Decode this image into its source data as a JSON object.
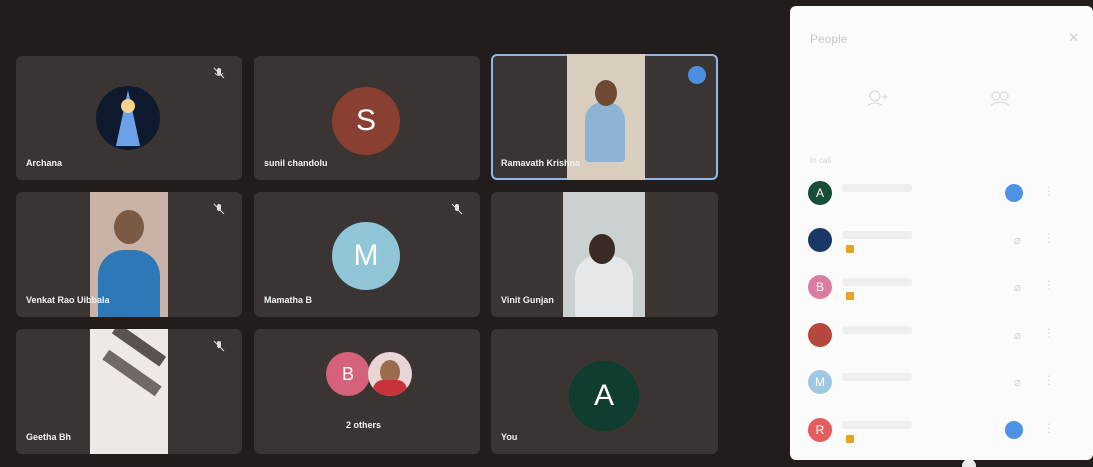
{
  "participants": [
    {
      "name": "Archana"
    },
    {
      "name": "sunil chandolu",
      "initial": "S"
    },
    {
      "name": "Ramavath Krishna"
    },
    {
      "name": "Venkat Rao Uibbala"
    },
    {
      "name": "Mamatha B",
      "initial": "M"
    },
    {
      "name": "Vinit Gunjan"
    },
    {
      "name": "Geetha Bh"
    },
    {
      "name": "2 others",
      "initial": "B"
    },
    {
      "name": "You",
      "initial": "A"
    }
  ],
  "people_panel": {
    "title": "People",
    "section": "In call",
    "rows": [
      {
        "initial": "A"
      },
      {
        "initial": ""
      },
      {
        "initial": "B"
      },
      {
        "initial": ""
      },
      {
        "initial": "M"
      },
      {
        "initial": "R"
      }
    ]
  }
}
